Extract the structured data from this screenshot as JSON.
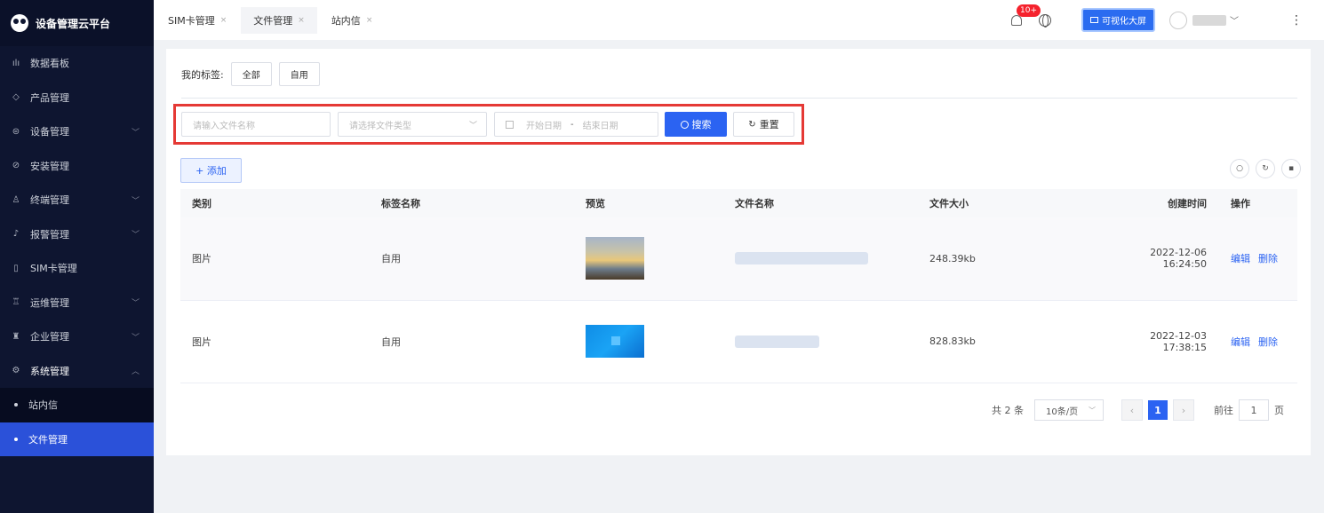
{
  "app": {
    "title": "设备管理云平台"
  },
  "sidebar": {
    "items": [
      {
        "label": "数据看板",
        "icon": "bar-chart-icon",
        "glyph": "ılı",
        "chev": ""
      },
      {
        "label": "产品管理",
        "icon": "cube-icon",
        "glyph": "◇",
        "chev": ""
      },
      {
        "label": "设备管理",
        "icon": "device-icon",
        "glyph": "⊜",
        "chev": "﹀"
      },
      {
        "label": "安装管理",
        "icon": "install-icon",
        "glyph": "⊘",
        "chev": ""
      },
      {
        "label": "终端管理",
        "icon": "terminal-icon",
        "glyph": "♙",
        "chev": "﹀"
      },
      {
        "label": "报警管理",
        "icon": "alarm-icon",
        "glyph": "♪",
        "chev": "﹀"
      },
      {
        "label": "SIM卡管理",
        "icon": "sim-card-icon",
        "glyph": "▯",
        "chev": ""
      },
      {
        "label": "运维管理",
        "icon": "ops-icon",
        "glyph": "♖",
        "chev": "﹀"
      },
      {
        "label": "企业管理",
        "icon": "company-icon",
        "glyph": "♜",
        "chev": "﹀"
      },
      {
        "label": "系统管理",
        "icon": "gear-icon",
        "glyph": "⚙",
        "chev": "︿"
      }
    ],
    "subitems": [
      {
        "label": "站内信"
      },
      {
        "label": "文件管理"
      }
    ]
  },
  "tabs": [
    {
      "label": "SIM卡管理",
      "close": "×"
    },
    {
      "label": "文件管理",
      "close": "×"
    },
    {
      "label": "站内信",
      "close": "×"
    }
  ],
  "header": {
    "badge": "10+",
    "bigscreen_label": "可视化大屏",
    "dd_chevron": "﹀",
    "more": "⋮"
  },
  "tags": {
    "label": "我的标签:",
    "items": [
      "全部",
      "自用"
    ]
  },
  "search": {
    "name_placeholder": "请输入文件名称",
    "type_placeholder": "请选择文件类型",
    "start_placeholder": "开始日期",
    "range_sep": "-",
    "end_placeholder": "结束日期",
    "search_label": "搜索",
    "reset_label": "重置"
  },
  "toolbar": {
    "add_label": "+ 添加"
  },
  "table": {
    "headers": [
      "类别",
      "标签名称",
      "预览",
      "文件名称",
      "文件大小",
      "创建时间",
      "操作"
    ],
    "rows": [
      {
        "category": "图片",
        "tag": "自用",
        "size": "248.39kb",
        "created": "2022-12-06 16:24:50",
        "edit": "编辑",
        "delete": "删除"
      },
      {
        "category": "图片",
        "tag": "自用",
        "size": "828.83kb",
        "created": "2022-12-03 17:38:15",
        "edit": "编辑",
        "delete": "删除"
      }
    ]
  },
  "pagination": {
    "total": "共 2 条",
    "page_size": "10条/页",
    "current": "1",
    "goto_label": "前往",
    "goto_value": "1",
    "page_suffix": "页"
  }
}
